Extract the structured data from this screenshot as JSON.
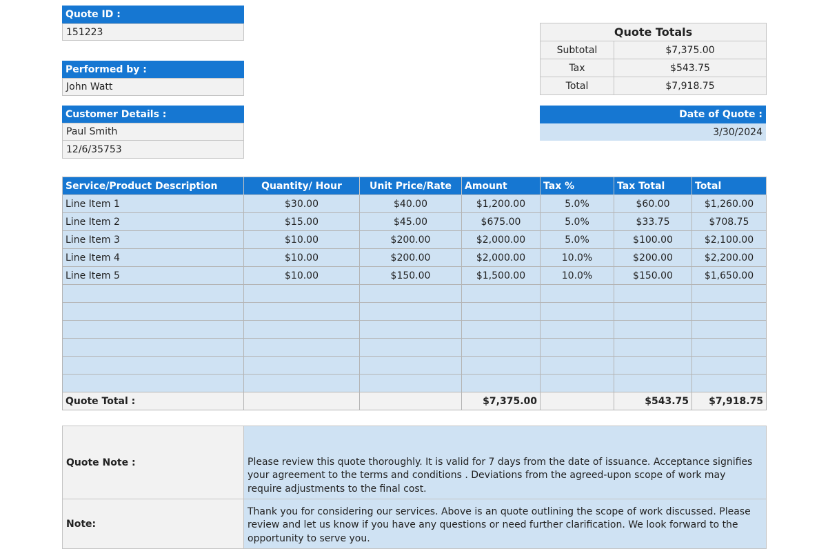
{
  "quote_id": {
    "label": "Quote ID :",
    "value": "151223"
  },
  "performed_by": {
    "label": "Performed by  :",
    "value": "John Watt"
  },
  "customer": {
    "label": "Customer Details :",
    "name": "Paul Smith",
    "detail": "12/6/35753"
  },
  "quote_totals": {
    "title": "Quote  Totals",
    "rows": [
      {
        "label": "Subtotal",
        "value": "$7,375.00"
      },
      {
        "label": "Tax",
        "value": "$543.75"
      },
      {
        "label": "Total",
        "value": "$7,918.75"
      }
    ]
  },
  "date_of_quote": {
    "label": "Date of Quote :",
    "value": "3/30/2024"
  },
  "items_table": {
    "headers": [
      "Service/Product Description",
      "Quantity/ Hour",
      "Unit Price/Rate",
      "Amount",
      "Tax %",
      "Tax Total",
      "Total"
    ],
    "rows": [
      [
        "Line Item 1",
        "$30.00",
        "$40.00",
        "$1,200.00",
        "5.0%",
        "$60.00",
        "$1,260.00"
      ],
      [
        "Line Item 2",
        "$15.00",
        "$45.00",
        "$675.00",
        "5.0%",
        "$33.75",
        "$708.75"
      ],
      [
        "Line Item 3",
        "$10.00",
        "$200.00",
        "$2,000.00",
        "5.0%",
        "$100.00",
        "$2,100.00"
      ],
      [
        "Line Item 4",
        "$10.00",
        "$200.00",
        "$2,000.00",
        "10.0%",
        "$200.00",
        "$2,200.00"
      ],
      [
        "Line Item 5",
        "$10.00",
        "$150.00",
        "$1,500.00",
        "10.0%",
        "$150.00",
        "$1,650.00"
      ]
    ],
    "footer": {
      "label": "Quote Total :",
      "amount": "$7,375.00",
      "tax_total": "$543.75",
      "total": "$7,918.75"
    }
  },
  "notes": [
    {
      "label": "Quote Note :",
      "text": "Please review this quote thoroughly. It is valid for 7 days from the date of issuance. Acceptance signifies your agreement to the terms and conditions . Deviations from the agreed-upon scope of work may require adjustments to the final cost."
    },
    {
      "label": "Note:",
      "text": "Thank you for considering our services. Above is an quote outlining the scope of work discussed. Please review and let us know if you have any questions or need further clarification. We look forward to the opportunity to serve you."
    }
  ],
  "colors": {
    "header_blue": "#1677d2",
    "cell_blue": "#cfe2f3",
    "cell_gray": "#f2f2f2"
  }
}
